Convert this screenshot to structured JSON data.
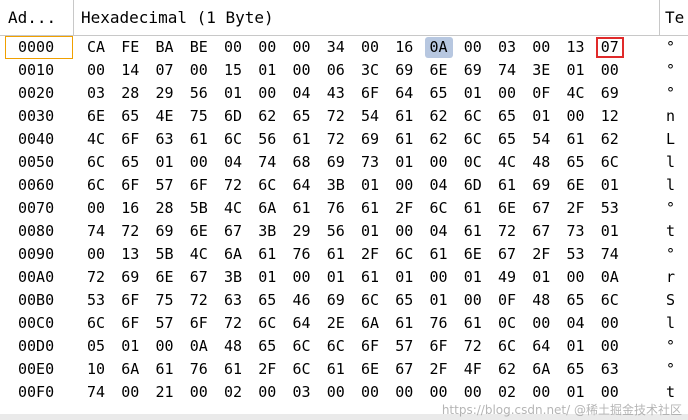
{
  "header": {
    "address_label": "Ad...",
    "hex_label": "Hexadecimal (1 Byte)",
    "text_label": "Te"
  },
  "rows": [
    {
      "addr": "0000",
      "bytes": [
        "CA",
        "FE",
        "BA",
        "BE",
        "00",
        "00",
        "00",
        "34",
        "00",
        "16",
        "0A",
        "00",
        "03",
        "00",
        "13",
        "07"
      ],
      "ascii": "°"
    },
    {
      "addr": "0010",
      "bytes": [
        "00",
        "14",
        "07",
        "00",
        "15",
        "01",
        "00",
        "06",
        "3C",
        "69",
        "6E",
        "69",
        "74",
        "3E",
        "01",
        "00"
      ],
      "ascii": "°"
    },
    {
      "addr": "0020",
      "bytes": [
        "03",
        "28",
        "29",
        "56",
        "01",
        "00",
        "04",
        "43",
        "6F",
        "64",
        "65",
        "01",
        "00",
        "0F",
        "4C",
        "69"
      ],
      "ascii": "°"
    },
    {
      "addr": "0030",
      "bytes": [
        "6E",
        "65",
        "4E",
        "75",
        "6D",
        "62",
        "65",
        "72",
        "54",
        "61",
        "62",
        "6C",
        "65",
        "01",
        "00",
        "12"
      ],
      "ascii": "n"
    },
    {
      "addr": "0040",
      "bytes": [
        "4C",
        "6F",
        "63",
        "61",
        "6C",
        "56",
        "61",
        "72",
        "69",
        "61",
        "62",
        "6C",
        "65",
        "54",
        "61",
        "62"
      ],
      "ascii": "L"
    },
    {
      "addr": "0050",
      "bytes": [
        "6C",
        "65",
        "01",
        "00",
        "04",
        "74",
        "68",
        "69",
        "73",
        "01",
        "00",
        "0C",
        "4C",
        "48",
        "65",
        "6C"
      ],
      "ascii": "l"
    },
    {
      "addr": "0060",
      "bytes": [
        "6C",
        "6F",
        "57",
        "6F",
        "72",
        "6C",
        "64",
        "3B",
        "01",
        "00",
        "04",
        "6D",
        "61",
        "69",
        "6E",
        "01"
      ],
      "ascii": "l"
    },
    {
      "addr": "0070",
      "bytes": [
        "00",
        "16",
        "28",
        "5B",
        "4C",
        "6A",
        "61",
        "76",
        "61",
        "2F",
        "6C",
        "61",
        "6E",
        "67",
        "2F",
        "53"
      ],
      "ascii": "°"
    },
    {
      "addr": "0080",
      "bytes": [
        "74",
        "72",
        "69",
        "6E",
        "67",
        "3B",
        "29",
        "56",
        "01",
        "00",
        "04",
        "61",
        "72",
        "67",
        "73",
        "01"
      ],
      "ascii": "t"
    },
    {
      "addr": "0090",
      "bytes": [
        "00",
        "13",
        "5B",
        "4C",
        "6A",
        "61",
        "76",
        "61",
        "2F",
        "6C",
        "61",
        "6E",
        "67",
        "2F",
        "53",
        "74"
      ],
      "ascii": "°"
    },
    {
      "addr": "00A0",
      "bytes": [
        "72",
        "69",
        "6E",
        "67",
        "3B",
        "01",
        "00",
        "01",
        "61",
        "01",
        "00",
        "01",
        "49",
        "01",
        "00",
        "0A"
      ],
      "ascii": "r"
    },
    {
      "addr": "00B0",
      "bytes": [
        "53",
        "6F",
        "75",
        "72",
        "63",
        "65",
        "46",
        "69",
        "6C",
        "65",
        "01",
        "00",
        "0F",
        "48",
        "65",
        "6C"
      ],
      "ascii": "S"
    },
    {
      "addr": "00C0",
      "bytes": [
        "6C",
        "6F",
        "57",
        "6F",
        "72",
        "6C",
        "64",
        "2E",
        "6A",
        "61",
        "76",
        "61",
        "0C",
        "00",
        "04",
        "00"
      ],
      "ascii": "l"
    },
    {
      "addr": "00D0",
      "bytes": [
        "05",
        "01",
        "00",
        "0A",
        "48",
        "65",
        "6C",
        "6C",
        "6F",
        "57",
        "6F",
        "72",
        "6C",
        "64",
        "01",
        "00"
      ],
      "ascii": "°"
    },
    {
      "addr": "00E0",
      "bytes": [
        "10",
        "6A",
        "61",
        "76",
        "61",
        "2F",
        "6C",
        "61",
        "6E",
        "67",
        "2F",
        "4F",
        "62",
        "6A",
        "65",
        "63"
      ],
      "ascii": "°"
    },
    {
      "addr": "00F0",
      "bytes": [
        "74",
        "00",
        "21",
        "00",
        "02",
        "00",
        "03",
        "00",
        "00",
        "00",
        "00",
        "00",
        "02",
        "00",
        "01",
        "00"
      ],
      "ascii": "t"
    }
  ],
  "selected_row": 0,
  "highlight": {
    "row": 0,
    "col": 10,
    "color": "#b7c7e0"
  },
  "boxed": {
    "row": 0,
    "col": 15,
    "color": "#e02a2a"
  },
  "watermark": "https://blog.csdn.net/  @稀土掘金技术社区"
}
